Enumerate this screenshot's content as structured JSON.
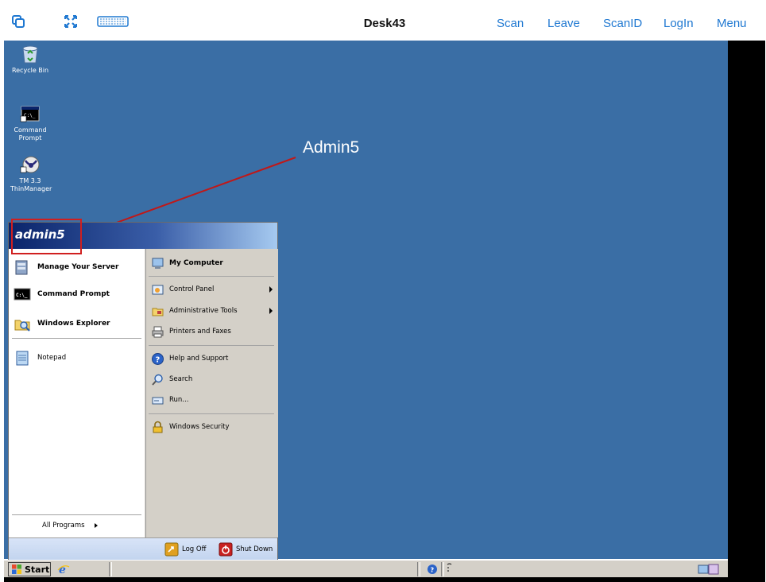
{
  "toolbar": {
    "title": "Desk43",
    "links": [
      "Scan",
      "Leave",
      "ScanID",
      "LogIn",
      "Menu"
    ],
    "icons": [
      "windows-icon",
      "fullscreen-icon",
      "keyboard-icon"
    ]
  },
  "desktop": {
    "icons": [
      {
        "label": "Recycle Bin",
        "icon": "recycle-bin-icon"
      },
      {
        "label": "Command Prompt",
        "icon": "command-prompt-icon"
      },
      {
        "label": "TM 3.3 ThinManager",
        "icon": "thinmanager-icon"
      }
    ],
    "annotation": "Admin5",
    "background_color": "#3a6ea5"
  },
  "start_menu": {
    "user": "admin5",
    "pinned": [
      {
        "label": "Manage Your Server",
        "icon": "server-icon"
      },
      {
        "label": "Command Prompt",
        "icon": "command-prompt-icon"
      },
      {
        "label": "Windows Explorer",
        "icon": "explorer-icon"
      }
    ],
    "recent": [
      {
        "label": "Notepad",
        "icon": "notepad-icon"
      }
    ],
    "all_programs": "All Programs",
    "right": [
      {
        "label": "My Computer",
        "icon": "my-computer-icon",
        "bold": true,
        "submenu": false
      },
      {
        "label": "Control Panel",
        "icon": "control-panel-icon",
        "bold": false,
        "submenu": true
      },
      {
        "label": "Administrative Tools",
        "icon": "admin-tools-icon",
        "bold": false,
        "submenu": true
      },
      {
        "label": "Printers and Faxes",
        "icon": "printer-icon",
        "bold": false,
        "submenu": false
      },
      {
        "label": "Help and Support",
        "icon": "help-icon",
        "bold": false,
        "submenu": false
      },
      {
        "label": "Search",
        "icon": "search-icon",
        "bold": false,
        "submenu": false
      },
      {
        "label": "Run...",
        "icon": "run-icon",
        "bold": false,
        "submenu": false
      },
      {
        "label": "Windows Security",
        "icon": "lock-icon",
        "bold": false,
        "submenu": false
      }
    ],
    "log_off": "Log Off",
    "shut_down": "Shut Down"
  },
  "taskbar": {
    "start": "Start"
  },
  "colors": {
    "accent": "#1f78d1",
    "annotation_red": "#d01f1f",
    "header_dark": "#0a246a"
  }
}
